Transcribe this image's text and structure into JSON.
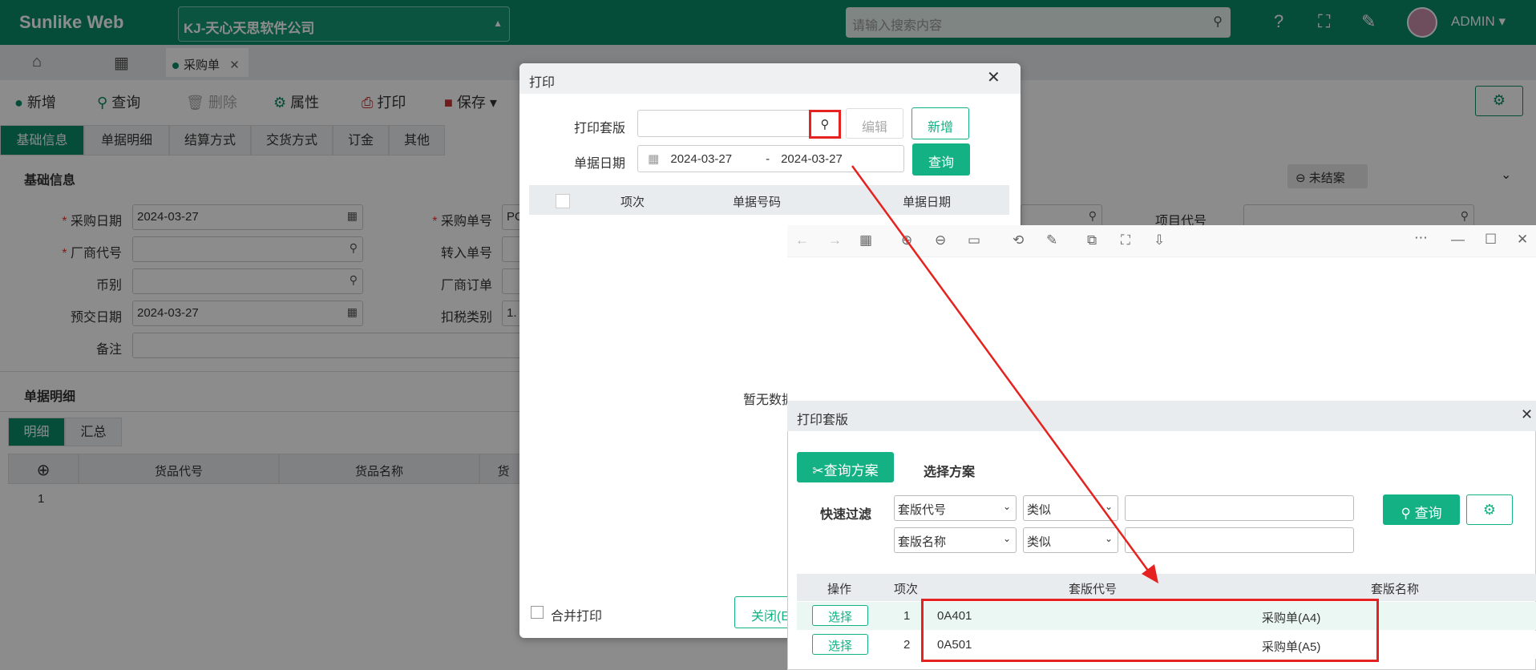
{
  "header": {
    "brand": "Sunlike Web",
    "company": "KJ-天心天思软件公司",
    "search_placeholder": "请输入搜索内容",
    "user": "ADMIN"
  },
  "tabs": {
    "active": "采购单"
  },
  "toolbar": {
    "add": "新增",
    "query": "查询",
    "delete": "删除",
    "props": "属性",
    "print": "打印",
    "save": "保存"
  },
  "subtabs": [
    "基础信息",
    "单据明细",
    "结算方式",
    "交货方式",
    "订金",
    "其他"
  ],
  "basic": {
    "title": "基础信息",
    "status": "未结案",
    "purchase_date_label": "采购日期",
    "purchase_date": "2024-03-27",
    "vendor_label": "厂商代号",
    "currency_label": "币别",
    "delivery_label": "预交日期",
    "delivery_date": "2024-03-27",
    "note_label": "备注",
    "po_no_label": "采购单号",
    "po_no_partial": "PO",
    "transfer_label": "转入单号",
    "vendor_order_label": "厂商订单",
    "tax_label": "扣税类别",
    "tax_partial": "1.",
    "project_label": "项目代号"
  },
  "detail": {
    "title": "单据明细",
    "tab_detail": "明细",
    "tab_summary": "汇总",
    "col_code": "货品代号",
    "col_name": "货品名称",
    "col_partial": "货",
    "row1": "1"
  },
  "print": {
    "title": "打印",
    "template_label": "打印套版",
    "edit": "编辑",
    "add": "新增",
    "date_label": "单据日期",
    "date_from": "2024-03-27",
    "date_sep": "-",
    "date_to": "2024-03-27",
    "query": "查询",
    "col_seq": "项次",
    "col_no": "单据号码",
    "col_date": "单据日期",
    "empty": "暂无数据",
    "merge": "合并打印",
    "close": "关闭(E"
  },
  "template_dialog": {
    "title": "打印套版",
    "query_scheme": "查询方案",
    "select_scheme": "选择方案",
    "quick_filter": "快速过滤",
    "field1": "套版代号",
    "op1": "类似",
    "field2": "套版名称",
    "op2": "类似",
    "query": "查询",
    "col_op": "操作",
    "col_seq": "项次",
    "col_code": "套版代号",
    "col_name": "套版名称",
    "rows": [
      {
        "btn": "选择",
        "seq": "1",
        "code": "0A401",
        "name": "采购单(A4)"
      },
      {
        "btn": "选择",
        "seq": "2",
        "code": "0A501",
        "name": "采购单(A5)"
      }
    ]
  },
  "colors": {
    "primary": "#0a8a68",
    "accent": "#13b183",
    "highlight": "#e5221f"
  }
}
